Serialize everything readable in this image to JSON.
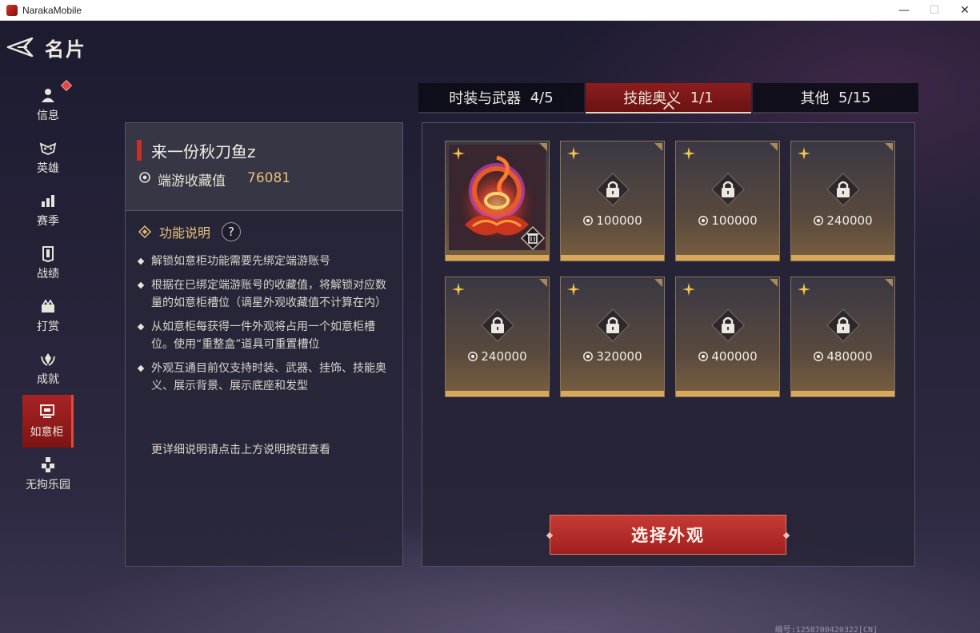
{
  "window": {
    "title": "NarakaMobile",
    "controls": {
      "minimize": "—",
      "maximize": "☐",
      "close": "✕"
    }
  },
  "header": {
    "title": "名片"
  },
  "nav": {
    "items": [
      {
        "label": "信息",
        "icon": "user-icon",
        "badge": true
      },
      {
        "label": "英雄",
        "icon": "mask-icon"
      },
      {
        "label": "赛季",
        "icon": "bars-icon"
      },
      {
        "label": "战绩",
        "icon": "shield-icon"
      },
      {
        "label": "打赏",
        "icon": "gift-icon"
      },
      {
        "label": "成就",
        "icon": "laurel-icon"
      },
      {
        "label": "如意柜",
        "icon": "cabinet-icon",
        "active": true
      },
      {
        "label": "无拘乐园",
        "icon": "cubes-icon"
      }
    ]
  },
  "info": {
    "player_name": "来一份秋刀鱼z",
    "collection_label": "端游收藏值",
    "collection_value": "76081",
    "function_label": "功能说明",
    "help_symbol": "?",
    "bullets": [
      "解锁如意柜功能需要先绑定端游账号",
      "根据在已绑定端游账号的收藏值，将解锁对应数量的如意柜槽位（谪星外观收藏值不计算在内）",
      "从如意柜每获得一件外观将占用一个如意柜槽位。使用“重整盒”道具可重置槽位",
      "外观互通目前仅支持时装、武器、挂饰、技能奥义、展示背景、展示底座和发型"
    ],
    "more_info": "更详细说明请点击上方说明按钮查看"
  },
  "tabs": [
    {
      "label": "时装与武器",
      "count": "4/5"
    },
    {
      "label": "技能奥义",
      "count": "1/1",
      "active": true
    },
    {
      "label": "其他",
      "count": "5/15"
    }
  ],
  "slots": [
    {
      "state": "filled",
      "item": "flame-orb-art"
    },
    {
      "state": "locked",
      "requirement": "100000"
    },
    {
      "state": "locked",
      "requirement": "100000"
    },
    {
      "state": "locked",
      "requirement": "240000"
    },
    {
      "state": "locked",
      "requirement": "240000"
    },
    {
      "state": "locked",
      "requirement": "320000"
    },
    {
      "state": "locked",
      "requirement": "400000"
    },
    {
      "state": "locked",
      "requirement": "480000"
    }
  ],
  "select_button": "选择外观",
  "footer_id": "编号:1258700420322[CN]",
  "colors": {
    "accent_red": "#a82424",
    "gold": "#e3c07a",
    "slot_bar": "#d8a95a"
  }
}
